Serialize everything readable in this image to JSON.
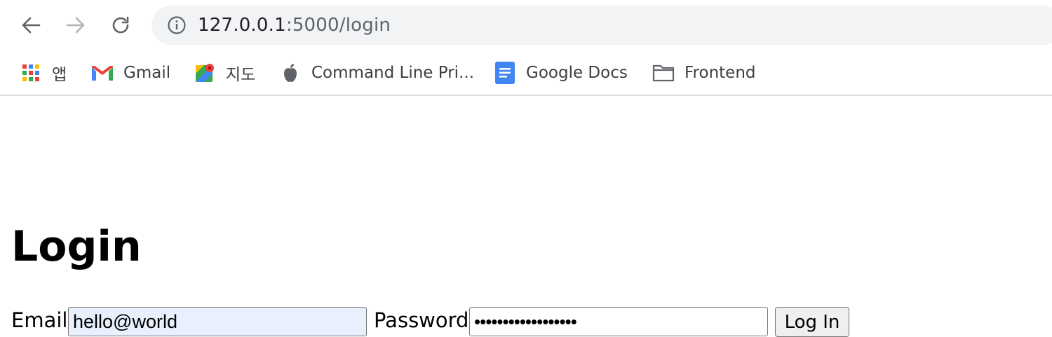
{
  "browser": {
    "url_host": "127.0.0.1",
    "url_path": ":5000/login"
  },
  "bookmarks": [
    {
      "label": "앱",
      "icon": "apps-grid-icon"
    },
    {
      "label": "Gmail",
      "icon": "gmail-icon"
    },
    {
      "label": "지도",
      "icon": "maps-icon"
    },
    {
      "label": "Command Line Pri...",
      "icon": "apple-icon"
    },
    {
      "label": "Google Docs",
      "icon": "docs-icon"
    },
    {
      "label": "Frontend",
      "icon": "folder-icon"
    }
  ],
  "page": {
    "title": "Login",
    "email_label": "Email",
    "email_value": "hello@world",
    "password_label": "Password",
    "password_value": "••••••••••••••••••",
    "login_button": "Log In"
  },
  "colors": {
    "autofill_bg": "#e8f0fe",
    "omnibox_bg": "#f1f3f4",
    "docs_blue": "#4285f4",
    "gmail_red": "#ea4335"
  }
}
